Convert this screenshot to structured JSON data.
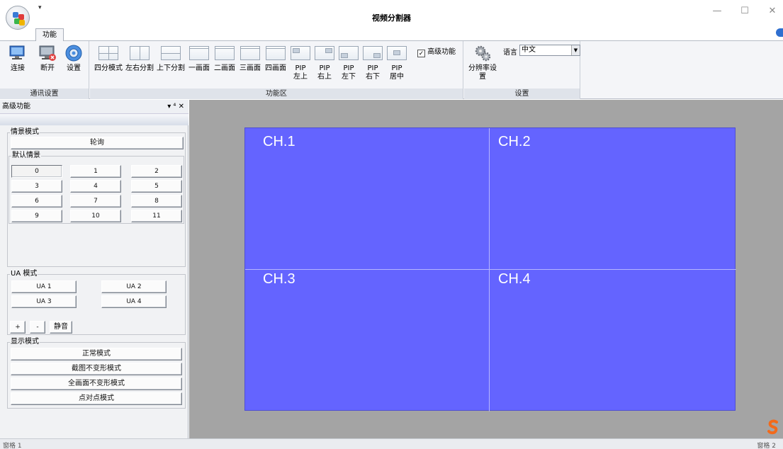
{
  "window": {
    "title": "视频分割器",
    "qat_glyph": "▾",
    "minimize": "—",
    "maximize": "☐",
    "close": "✕"
  },
  "tabs": [
    {
      "label": "功能",
      "active": true
    }
  ],
  "ribbon": {
    "comm_group": {
      "label": "通讯设置",
      "buttons": [
        {
          "label": "连接",
          "icon": "monitor-connect-icon"
        },
        {
          "label": "断开",
          "icon": "monitor-disconnect-icon"
        },
        {
          "label": "设置",
          "icon": "settings-icon"
        }
      ]
    },
    "func_group": {
      "label": "功能区",
      "buttons": [
        {
          "line1": "四分模式",
          "line2": ""
        },
        {
          "line1": "左右分割",
          "line2": ""
        },
        {
          "line1": "上下分割",
          "line2": ""
        },
        {
          "line1": "一画面",
          "line2": ""
        },
        {
          "line1": "二画面",
          "line2": ""
        },
        {
          "line1": "三画面",
          "line2": ""
        },
        {
          "line1": "四画面",
          "line2": ""
        },
        {
          "line1": "PIP",
          "line2": "左上"
        },
        {
          "line1": "PIP",
          "line2": "右上"
        },
        {
          "line1": "PIP",
          "line2": "左下"
        },
        {
          "line1": "PIP",
          "line2": "右下"
        },
        {
          "line1": "PIP",
          "line2": "居中"
        }
      ],
      "advanced_checkbox": {
        "label": "高级功能",
        "checked": true
      }
    },
    "settings_group": {
      "label": "设置",
      "resolution_label": "分辨率设置",
      "language_label": "语言",
      "language_value": "中文"
    }
  },
  "panel": {
    "title": "高级功能",
    "controls": "▾ ⁴ ✕",
    "scene_mode": {
      "legend": "情景模式",
      "poll_button": "轮询",
      "default_legend": "默认情景",
      "scenes": [
        "0",
        "1",
        "2",
        "3",
        "4",
        "5",
        "6",
        "7",
        "8",
        "9",
        "10",
        "11"
      ]
    },
    "ua_mode": {
      "legend": "UA 模式",
      "buttons": [
        "UA 1",
        "UA 2",
        "UA 3",
        "UA 4"
      ],
      "plus": "+",
      "minus": "-",
      "mute": "静音"
    },
    "display_mode": {
      "legend": "显示模式",
      "buttons": [
        "正常模式",
        "截图不变形模式",
        "全画面不变形模式",
        "点对点模式"
      ]
    }
  },
  "channels": [
    "CH.1",
    "CH.2",
    "CH.3",
    "CH.4"
  ],
  "status": {
    "left": "窗格 1",
    "right": "窗格 2"
  },
  "colors": {
    "video_bg": "#6464ff",
    "main_bg": "#a4a4a4",
    "ribbon_bg": "#f4f5f8"
  }
}
